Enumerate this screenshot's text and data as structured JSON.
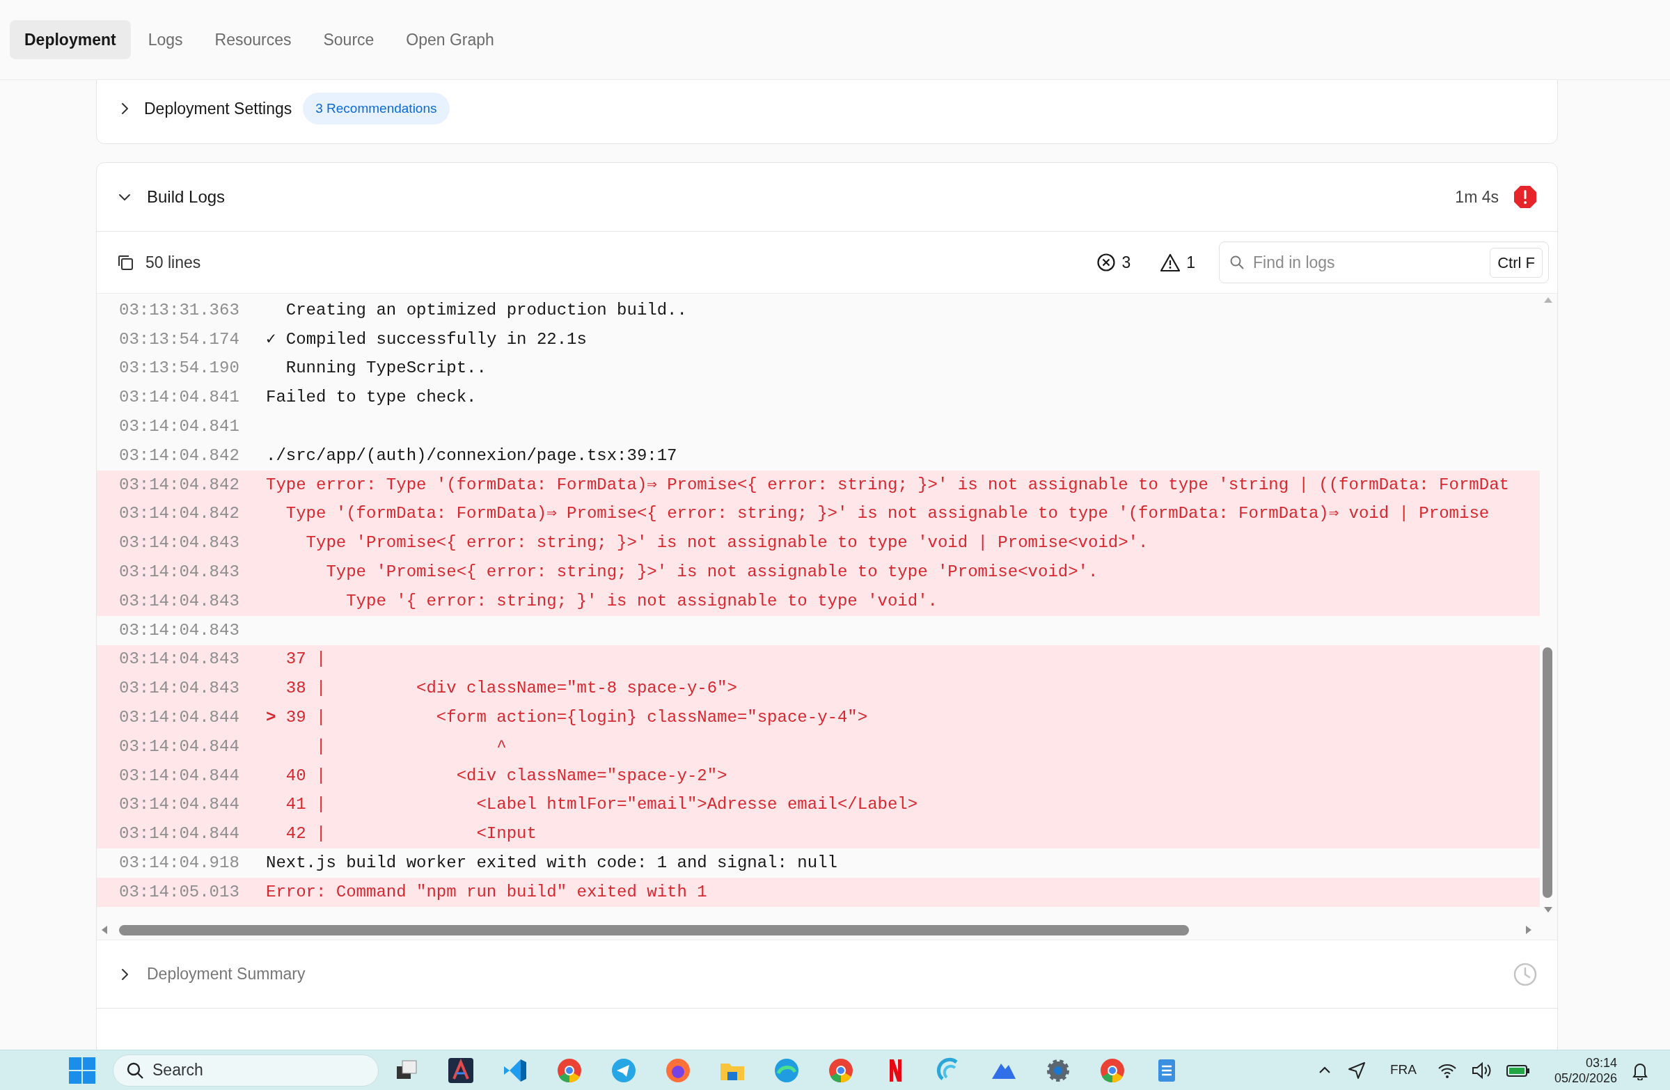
{
  "tabs": [
    {
      "label": "Deployment",
      "selected": true
    },
    {
      "label": "Logs",
      "selected": false
    },
    {
      "label": "Resources",
      "selected": false
    },
    {
      "label": "Source",
      "selected": false
    },
    {
      "label": "Open Graph",
      "selected": false
    }
  ],
  "settings": {
    "title": "Deployment Settings",
    "badge": "3 Recommendations",
    "expanded": false
  },
  "build_logs": {
    "title": "Build Logs",
    "expanded": true,
    "duration": "1m 4s",
    "line_count": "50 lines",
    "errors": "3",
    "warnings": "1",
    "search": {
      "placeholder": "Find in logs",
      "shortcut": "Ctrl F"
    },
    "lines": [
      {
        "time": "03:13:31.363",
        "text": "  Creating an optimized production build..",
        "kind": "info"
      },
      {
        "time": "03:13:54.174",
        "text": "✓ Compiled successfully in 22.1s",
        "kind": "info"
      },
      {
        "time": "03:13:54.190",
        "text": "  Running TypeScript..",
        "kind": "info"
      },
      {
        "time": "03:14:04.841",
        "text": "Failed to type check.",
        "kind": "info"
      },
      {
        "time": "03:14:04.841",
        "kind": "info"
      },
      {
        "time": "03:14:04.842",
        "text": "./src/app/(auth)/connexion/page.tsx:39:17",
        "kind": "info"
      },
      {
        "time": "03:14:04.842",
        "text": "Type error: Type '(formData: FormData)⇒ Promise<{ error: string; }>' is not assignable to type 'string | ((formData: FormDat",
        "kind": "error"
      },
      {
        "time": "03:14:04.842",
        "text": "  Type '(formData: FormData)⇒ Promise<{ error: string; }>' is not assignable to type '(formData: FormData)⇒ void | Promise",
        "kind": "error"
      },
      {
        "time": "03:14:04.843",
        "text": "    Type 'Promise<{ error: string; }>' is not assignable to type 'void | Promise<void>'.",
        "kind": "error"
      },
      {
        "time": "03:14:04.843",
        "text": "      Type 'Promise<{ error: string; }>' is not assignable to type 'Promise<void>'.",
        "kind": "error"
      },
      {
        "time": "03:14:04.843",
        "text": "        Type '{ error: string; }' is not assignable to type 'void'.",
        "kind": "error"
      },
      {
        "time": "03:14:04.843",
        "kind": "info"
      },
      {
        "time": "03:14:04.843",
        "text": "  37 |",
        "kind": "error"
      },
      {
        "time": "03:14:04.843",
        "text": "  38 |         <div className=\"mt-8 space-y-6\">",
        "kind": "error"
      },
      {
        "time": "03:14:04.844",
        "text": "**>** 39 |           <form action={login} className=\"space-y-4\">",
        "kind": "error"
      },
      {
        "time": "03:14:04.844",
        "text": "     |                 ^",
        "kind": "error"
      },
      {
        "time": "03:14:04.844",
        "text": "  40 |             <div className=\"space-y-2\">",
        "kind": "error"
      },
      {
        "time": "03:14:04.844",
        "text": "  41 |               <Label htmlFor=\"email\">Adresse email</Label>",
        "kind": "error"
      },
      {
        "time": "03:14:04.844",
        "text": "  42 |               <Input",
        "kind": "error"
      },
      {
        "time": "03:14:04.918",
        "text": "Next.js build worker exited with code: 1 and signal: null",
        "kind": "info"
      },
      {
        "time": "03:14:05.013",
        "text": "Error: Command \"npm run build\" exited with 1",
        "kind": "error"
      }
    ]
  },
  "summary": {
    "title": "Deployment Summary",
    "expanded": false
  },
  "taskbar": {
    "search_placeholder": "Search",
    "language": "FRA",
    "time": "03:14",
    "date": "05/20/2026"
  }
}
